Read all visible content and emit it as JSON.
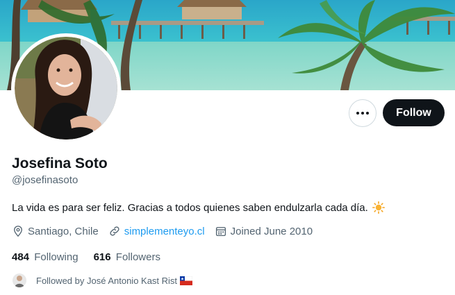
{
  "profile": {
    "name": "Josefina Soto",
    "handle": "@josefinasoto",
    "bio": "La vida es para ser feliz. Gracias a todos quienes saben endulzarla cada día.",
    "bio_emoji": "sun-icon",
    "location": "Santiago, Chile",
    "website": "simplementeyo.cl",
    "joined": "Joined June 2010"
  },
  "actions": {
    "follow_label": "Follow",
    "more_icon": "more-dots-icon"
  },
  "stats": {
    "following_count": "484",
    "following_label": "Following",
    "followers_count": "616",
    "followers_label": "Followers"
  },
  "social_context": {
    "text": "Followed by José Antonio Kast Rist",
    "flag": "chile-flag-icon"
  },
  "colors": {
    "text": "#0f1419",
    "secondary": "#536471",
    "link": "#1d9bf0",
    "follow_bg": "#0f1419"
  }
}
